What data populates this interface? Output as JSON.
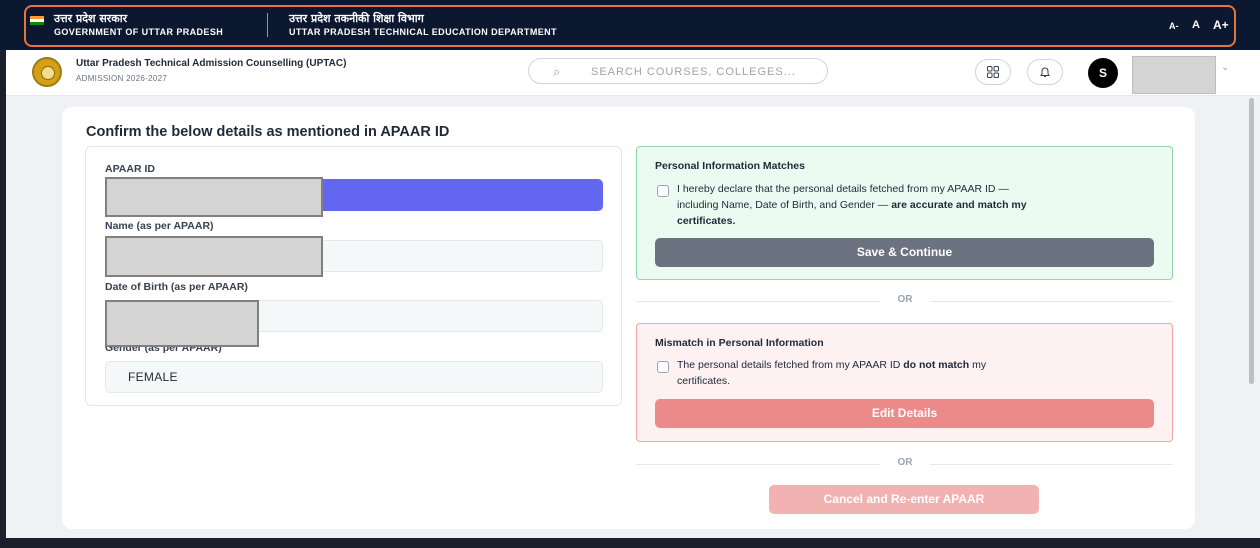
{
  "gov_bar": {
    "left_hindi": "उत्तर प्रदेश सरकार",
    "left_english": "GOVERNMENT OF UTTAR PRADESH",
    "right_hindi": "उत्तर प्रदेश तकनीकी शिक्षा विभाग",
    "right_english": "UTTAR PRADESH TECHNICAL EDUCATION DEPARTMENT",
    "font_controls": [
      "A-",
      "A",
      "A+"
    ]
  },
  "header": {
    "title": "Uttar Pradesh Technical Admission Counselling (UPTAC)",
    "subtitle": "ADMISSION 2026-2027",
    "search_placeholder": "SEARCH COURSES, COLLEGES...",
    "avatar_initial": "S"
  },
  "card": {
    "title": "Confirm the below details as mentioned in APAAR ID",
    "fields": [
      {
        "label": "APAAR ID",
        "value": ""
      },
      {
        "label": "Name (as per APAAR)",
        "value": ""
      },
      {
        "label": "Date of Birth (as per APAAR)",
        "value": ""
      },
      {
        "label": "Gender (as per APAAR)",
        "value": "FEMALE"
      }
    ],
    "match_panel": {
      "title": "Personal Information Matches",
      "text_1": "I hereby declare that the personal details fetched from my APAAR ID —",
      "text_2a": "including Name, Date of Birth, and Gender — ",
      "text_2b": "are accurate and match my",
      "text_3": "certificates.",
      "button": "Save & Continue"
    },
    "or_label": "OR",
    "mismatch_panel": {
      "title": "Mismatch in Personal Information",
      "text_1a": "The personal details fetched from my APAAR ID ",
      "text_1b": "do not match",
      "text_1c": " my",
      "text_2": "certificates.",
      "button": "Edit Details"
    },
    "cancel_button": "Cancel and Re-enter APAAR"
  },
  "colors": {
    "gov_bar_bg": "#0c1730",
    "highlight_outline": "#e8743b",
    "apaar_field_fill": "#6366f1",
    "match_panel_bg": "#ecfbf1",
    "mismatch_panel_bg": "#fdf1f1",
    "save_button": "#6b7280",
    "edit_button": "#ec8a8a",
    "cancel_button": "#f2b2b2"
  },
  "icons": {
    "search": "search-icon",
    "apps": "grid-icon",
    "notifications": "bell-icon",
    "user_menu": "chevron-down-icon"
  }
}
